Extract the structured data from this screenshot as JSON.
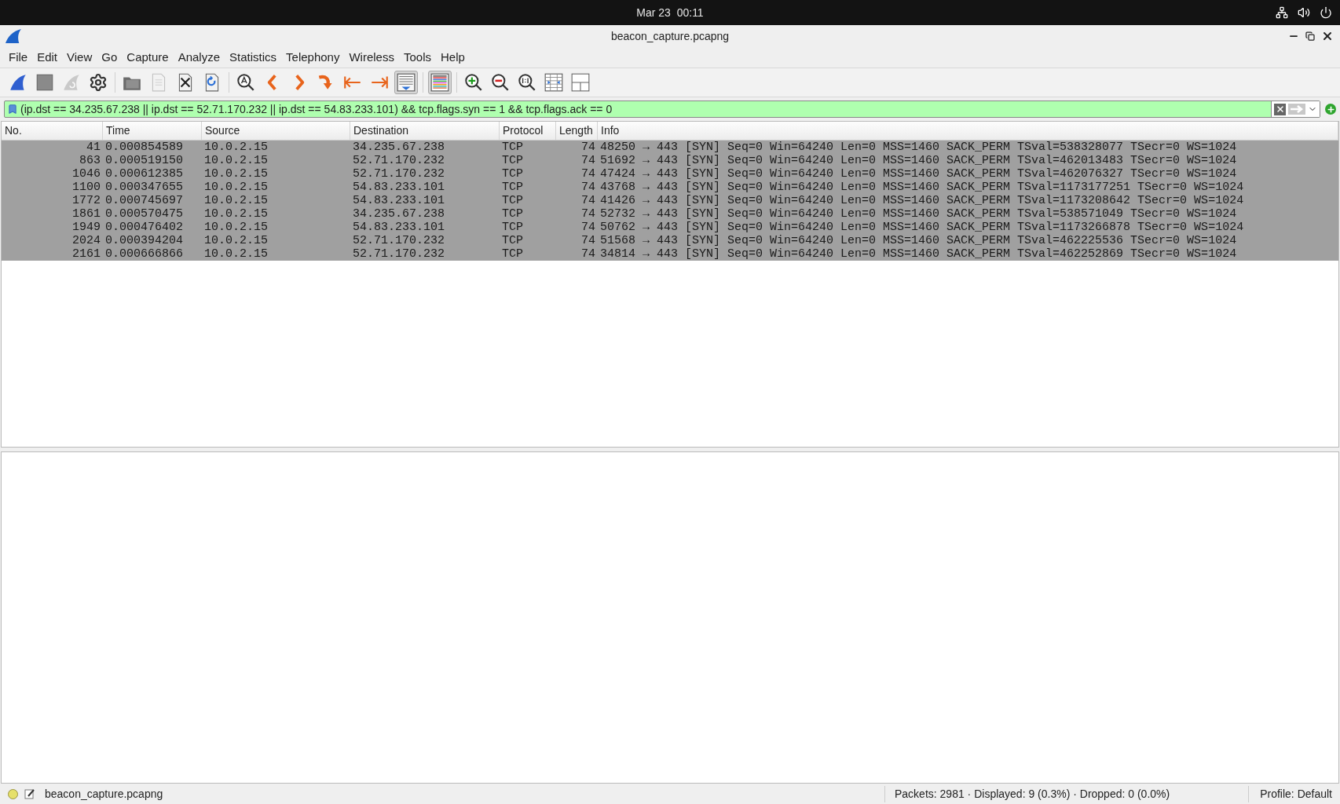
{
  "top_bar": {
    "clock": "Mar 23  00:11"
  },
  "window": {
    "title": "beacon_capture.pcapng"
  },
  "menu": [
    "File",
    "Edit",
    "View",
    "Go",
    "Capture",
    "Analyze",
    "Statistics",
    "Telephony",
    "Wireless",
    "Tools",
    "Help"
  ],
  "toolbar": [
    {
      "kind": "start",
      "disabled": false,
      "pressed": false
    },
    {
      "kind": "stop",
      "disabled": false,
      "pressed": false
    },
    {
      "kind": "restart",
      "disabled": true,
      "pressed": false
    },
    {
      "kind": "options",
      "disabled": false,
      "pressed": false
    },
    {
      "kind": "sep"
    },
    {
      "kind": "open",
      "disabled": false,
      "pressed": false
    },
    {
      "kind": "save",
      "disabled": true,
      "pressed": false
    },
    {
      "kind": "close",
      "disabled": false,
      "pressed": false
    },
    {
      "kind": "reload",
      "disabled": false,
      "pressed": false
    },
    {
      "kind": "sep"
    },
    {
      "kind": "find",
      "disabled": false,
      "pressed": false
    },
    {
      "kind": "back",
      "disabled": false,
      "pressed": false
    },
    {
      "kind": "forward",
      "disabled": false,
      "pressed": false
    },
    {
      "kind": "goto",
      "disabled": false,
      "pressed": false
    },
    {
      "kind": "first",
      "disabled": false,
      "pressed": false
    },
    {
      "kind": "last",
      "disabled": false,
      "pressed": false
    },
    {
      "kind": "autoscroll",
      "disabled": false,
      "pressed": true
    },
    {
      "kind": "sep"
    },
    {
      "kind": "colorize",
      "disabled": false,
      "pressed": true
    },
    {
      "kind": "sep"
    },
    {
      "kind": "zoomin",
      "disabled": false,
      "pressed": false
    },
    {
      "kind": "zoomout",
      "disabled": false,
      "pressed": false
    },
    {
      "kind": "zoomreset",
      "disabled": false,
      "pressed": false
    },
    {
      "kind": "resize",
      "disabled": false,
      "pressed": false
    },
    {
      "kind": "layout",
      "disabled": false,
      "pressed": false
    }
  ],
  "filter": {
    "value": "(ip.dst == 34.235.67.238 || ip.dst == 52.71.170.232 || ip.dst == 54.83.233.101) && tcp.flags.syn == 1 && tcp.flags.ack == 0",
    "valid": true
  },
  "packet_list": {
    "columns": [
      "No.",
      "Time",
      "Source",
      "Destination",
      "Protocol",
      "Length",
      "Info"
    ],
    "rows": [
      {
        "cells": [
          "41",
          "0.000854589",
          "10.0.2.15",
          "34.235.67.238",
          "TCP",
          "74",
          "48250 → 443 [SYN] Seq=0 Win=64240 Len=0 MSS=1460 SACK_PERM TSval=538328077 TSecr=0 WS=1024"
        ],
        "color": "#a0a0a0"
      },
      {
        "cells": [
          "863",
          "0.000519150",
          "10.0.2.15",
          "52.71.170.232",
          "TCP",
          "74",
          "51692 → 443 [SYN] Seq=0 Win=64240 Len=0 MSS=1460 SACK_PERM TSval=462013483 TSecr=0 WS=1024"
        ],
        "color": "#a0a0a0"
      },
      {
        "cells": [
          "1046",
          "0.000612385",
          "10.0.2.15",
          "52.71.170.232",
          "TCP",
          "74",
          "47424 → 443 [SYN] Seq=0 Win=64240 Len=0 MSS=1460 SACK_PERM TSval=462076327 TSecr=0 WS=1024"
        ],
        "color": "#a0a0a0"
      },
      {
        "cells": [
          "1100",
          "0.000347655",
          "10.0.2.15",
          "54.83.233.101",
          "TCP",
          "74",
          "43768 → 443 [SYN] Seq=0 Win=64240 Len=0 MSS=1460 SACK_PERM TSval=1173177251 TSecr=0 WS=1024"
        ],
        "color": "#a0a0a0"
      },
      {
        "cells": [
          "1772",
          "0.000745697",
          "10.0.2.15",
          "54.83.233.101",
          "TCP",
          "74",
          "41426 → 443 [SYN] Seq=0 Win=64240 Len=0 MSS=1460 SACK_PERM TSval=1173208642 TSecr=0 WS=1024"
        ],
        "color": "#a0a0a0"
      },
      {
        "cells": [
          "1861",
          "0.000570475",
          "10.0.2.15",
          "34.235.67.238",
          "TCP",
          "74",
          "52732 → 443 [SYN] Seq=0 Win=64240 Len=0 MSS=1460 SACK_PERM TSval=538571049 TSecr=0 WS=1024"
        ],
        "color": "#a0a0a0"
      },
      {
        "cells": [
          "1949",
          "0.000476402",
          "10.0.2.15",
          "54.83.233.101",
          "TCP",
          "74",
          "50762 → 443 [SYN] Seq=0 Win=64240 Len=0 MSS=1460 SACK_PERM TSval=1173266878 TSecr=0 WS=1024"
        ],
        "color": "#a0a0a0"
      },
      {
        "cells": [
          "2024",
          "0.000394204",
          "10.0.2.15",
          "52.71.170.232",
          "TCP",
          "74",
          "51568 → 443 [SYN] Seq=0 Win=64240 Len=0 MSS=1460 SACK_PERM TSval=462225536 TSecr=0 WS=1024"
        ],
        "color": "#a0a0a0"
      },
      {
        "cells": [
          "2161",
          "0.000666866",
          "10.0.2.15",
          "52.71.170.232",
          "TCP",
          "74",
          "34814 → 443 [SYN] Seq=0 Win=64240 Len=0 MSS=1460 SACK_PERM TSval=462252869 TSecr=0 WS=1024"
        ],
        "color": "#a0a0a0"
      }
    ]
  },
  "status_bar": {
    "file": "beacon_capture.pcapng",
    "stats": "Packets: 2981 · Displayed: 9 (0.3%) · Dropped: 0 (0.0%)",
    "profile": "Profile: Default"
  }
}
